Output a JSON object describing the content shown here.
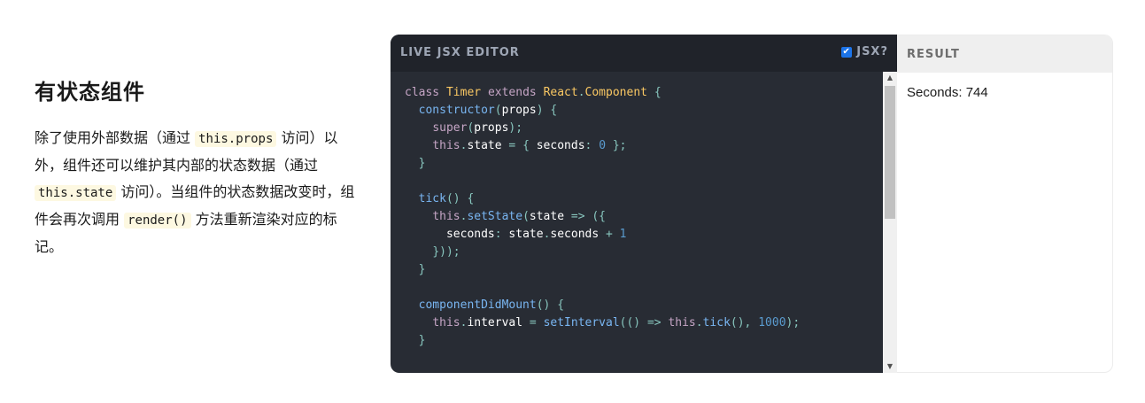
{
  "intro": {
    "heading": "有状态组件",
    "p1": "除了使用外部数据（通过 ",
    "code1": "this.props",
    "p2": " 访问）以外，组件还可以维护其内部的状态数据（通过 ",
    "code2": "this.state",
    "p3": " 访问）。当组件的状态数据改变时，组件会再次调用 ",
    "code3": "render()",
    "p4": " 方法重新渲染对应的标记。"
  },
  "editor": {
    "title": "LIVE JSX EDITOR",
    "jsx_label": "JSX?",
    "jsx_checked": true,
    "code_lines": [
      [
        [
          "kw",
          "class "
        ],
        [
          "cls",
          "Timer "
        ],
        [
          "kw",
          "extends "
        ],
        [
          "cls",
          "React"
        ],
        [
          "pun",
          "."
        ],
        [
          "cls",
          "Component "
        ],
        [
          "pun",
          "{"
        ]
      ],
      [
        [
          "prop",
          "  "
        ],
        [
          "fn",
          "constructor"
        ],
        [
          "pun",
          "("
        ],
        [
          "prop",
          "props"
        ],
        [
          "pun",
          ") {"
        ]
      ],
      [
        [
          "prop",
          "    "
        ],
        [
          "kw",
          "super"
        ],
        [
          "pun",
          "("
        ],
        [
          "prop",
          "props"
        ],
        [
          "pun",
          ");"
        ]
      ],
      [
        [
          "prop",
          "    "
        ],
        [
          "this",
          "this"
        ],
        [
          "pun",
          "."
        ],
        [
          "prop",
          "state "
        ],
        [
          "pun",
          "= { "
        ],
        [
          "prop",
          "seconds"
        ],
        [
          "pun",
          ": "
        ],
        [
          "num",
          "0"
        ],
        [
          "pun",
          " };"
        ]
      ],
      [
        [
          "prop",
          "  "
        ],
        [
          "pun",
          "}"
        ]
      ],
      [
        [
          "prop",
          ""
        ]
      ],
      [
        [
          "prop",
          "  "
        ],
        [
          "fn",
          "tick"
        ],
        [
          "pun",
          "() {"
        ]
      ],
      [
        [
          "prop",
          "    "
        ],
        [
          "this",
          "this"
        ],
        [
          "pun",
          "."
        ],
        [
          "fn",
          "setState"
        ],
        [
          "pun",
          "("
        ],
        [
          "prop",
          "state "
        ],
        [
          "pun",
          "=> ({"
        ]
      ],
      [
        [
          "prop",
          "      "
        ],
        [
          "prop",
          "seconds"
        ],
        [
          "pun",
          ": "
        ],
        [
          "prop",
          "state"
        ],
        [
          "pun",
          "."
        ],
        [
          "prop",
          "seconds "
        ],
        [
          "pun",
          "+ "
        ],
        [
          "num",
          "1"
        ]
      ],
      [
        [
          "prop",
          "    "
        ],
        [
          "pun",
          "}));"
        ]
      ],
      [
        [
          "prop",
          "  "
        ],
        [
          "pun",
          "}"
        ]
      ],
      [
        [
          "prop",
          ""
        ]
      ],
      [
        [
          "prop",
          "  "
        ],
        [
          "fn",
          "componentDidMount"
        ],
        [
          "pun",
          "() {"
        ]
      ],
      [
        [
          "prop",
          "    "
        ],
        [
          "this",
          "this"
        ],
        [
          "pun",
          "."
        ],
        [
          "prop",
          "interval "
        ],
        [
          "pun",
          "= "
        ],
        [
          "fn",
          "setInterval"
        ],
        [
          "pun",
          "(() => "
        ],
        [
          "this",
          "this"
        ],
        [
          "pun",
          "."
        ],
        [
          "fn",
          "tick"
        ],
        [
          "pun",
          "(), "
        ],
        [
          "num",
          "1000"
        ],
        [
          "pun",
          ");"
        ]
      ],
      [
        [
          "prop",
          "  "
        ],
        [
          "pun",
          "}"
        ]
      ]
    ]
  },
  "result": {
    "title": "RESULT",
    "output": "Seconds: 744"
  }
}
